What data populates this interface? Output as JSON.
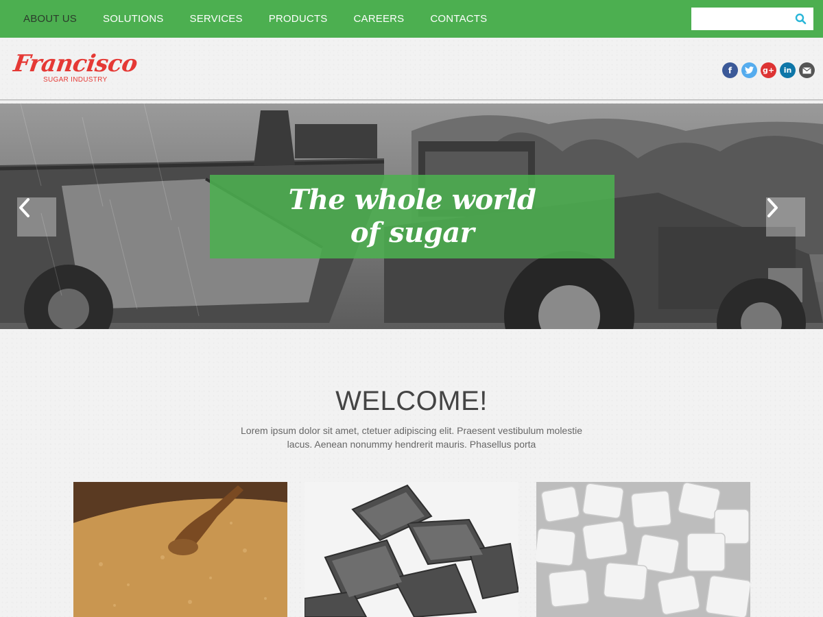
{
  "nav": {
    "items": [
      {
        "label": "ABOUT US",
        "active": true
      },
      {
        "label": "SOLUTIONS",
        "active": false
      },
      {
        "label": "SERVICES",
        "active": false
      },
      {
        "label": "PRODUCTS",
        "active": false
      },
      {
        "label": "CAREERS",
        "active": false
      },
      {
        "label": "CONTACTS",
        "active": false
      }
    ],
    "search": {
      "placeholder": "",
      "value": "",
      "icon": "search-icon"
    }
  },
  "brand": {
    "name": "Francisco",
    "tagline": "SUGAR INDUSTRY"
  },
  "social": [
    {
      "name": "facebook-icon",
      "glyph": "f",
      "color": "#3b5998"
    },
    {
      "name": "twitter-icon",
      "glyph": "t",
      "color": "#55acee"
    },
    {
      "name": "google-plus-icon",
      "glyph": "g+",
      "color": "#dd3333"
    },
    {
      "name": "linkedin-icon",
      "glyph": "in",
      "color": "#0e76a8"
    },
    {
      "name": "email-icon",
      "glyph": "✉",
      "color": "#555555"
    }
  ],
  "hero": {
    "line1": "The whole world",
    "line2": "of sugar",
    "prev_icon": "chevron-left-icon",
    "next_icon": "chevron-right-icon"
  },
  "welcome": {
    "title": "WELCOME!",
    "text": "Lorem ipsum dolor sit amet, ctetuer adipiscing elit. Praesent vestibulum molestie lacus. Aenean nonummy hendrerit mauris. Phasellus porta"
  },
  "colors": {
    "accent": "#4caf50",
    "brand": "#e53935",
    "active_nav": "#2b3a2b"
  }
}
